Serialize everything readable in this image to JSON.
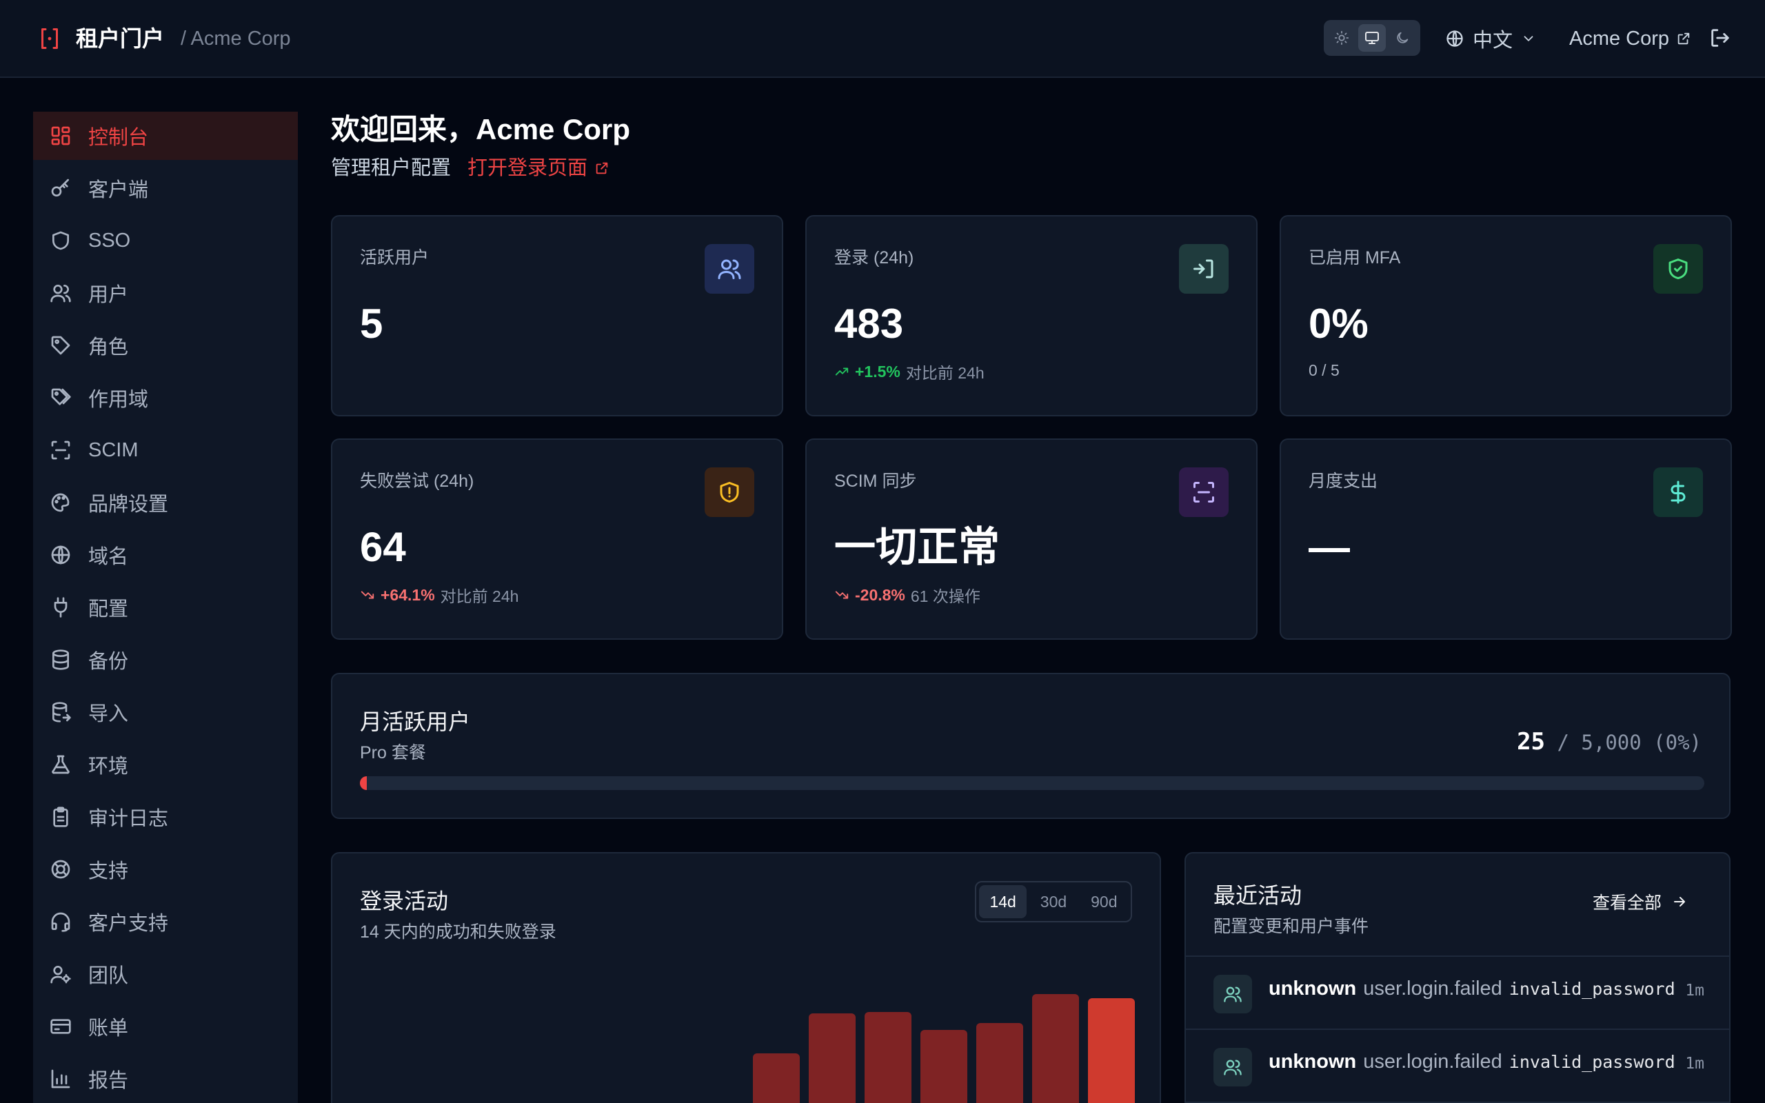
{
  "header": {
    "app_title": "租户门户",
    "tenant_path": "/ Acme Corp",
    "theme_options": [
      "light",
      "system",
      "dark"
    ],
    "theme_selected": "system",
    "language": "中文",
    "tenant_name": "Acme Corp"
  },
  "sidebar": {
    "items": [
      {
        "label": "控制台",
        "icon": "dashboard-icon",
        "active": true
      },
      {
        "label": "客户端",
        "icon": "key-icon"
      },
      {
        "label": "SSO",
        "icon": "shield-icon"
      },
      {
        "label": "用户",
        "icon": "users-icon"
      },
      {
        "label": "角色",
        "icon": "tag-icon"
      },
      {
        "label": "作用域",
        "icon": "tags-icon"
      },
      {
        "label": "SCIM",
        "icon": "scan-icon"
      },
      {
        "label": "品牌设置",
        "icon": "palette-icon"
      },
      {
        "label": "域名",
        "icon": "globe-icon"
      },
      {
        "label": "配置",
        "icon": "plug-icon"
      },
      {
        "label": "备份",
        "icon": "database-icon"
      },
      {
        "label": "导入",
        "icon": "database-import-icon"
      },
      {
        "label": "环境",
        "icon": "flask-icon"
      },
      {
        "label": "审计日志",
        "icon": "clipboard-icon"
      },
      {
        "label": "支持",
        "icon": "lifebuoy-icon"
      },
      {
        "label": "客户支持",
        "icon": "headset-icon"
      },
      {
        "label": "团队",
        "icon": "user-cog-icon"
      },
      {
        "label": "账单",
        "icon": "credit-card-icon"
      },
      {
        "label": "报告",
        "icon": "bar-chart-icon"
      }
    ]
  },
  "welcome": {
    "title": "欢迎回来，Acme Corp",
    "subtitle": "管理租户配置",
    "login_link": "打开登录页面"
  },
  "stats": [
    {
      "label": "活跃用户",
      "value": "5",
      "icon": "users-icon",
      "icon_bg": "#1e2a52",
      "icon_color": "#93b4ff"
    },
    {
      "label": "登录 (24h)",
      "value": "483",
      "delta": "+1.5%",
      "delta_dir": "up",
      "delta_note": "对比前 24h",
      "icon": "log-in-icon",
      "icon_bg": "#1f3b3d",
      "icon_color": "#b7e4e0"
    },
    {
      "label": "已启用 MFA",
      "value": "0%",
      "note": "0 / 5",
      "icon": "shield-check-icon",
      "icon_bg": "#123527",
      "icon_color": "#4ade80"
    },
    {
      "label": "失败尝试 (24h)",
      "value": "64",
      "delta": "+64.1%",
      "delta_dir": "down",
      "delta_note": "对比前 24h",
      "icon": "shield-alert-icon",
      "icon_bg": "#3a2316",
      "icon_color": "#fbbf24"
    },
    {
      "label": "SCIM 同步",
      "value": "一切正常",
      "delta": "-20.8%",
      "delta_dir": "down",
      "delta_note": "61 次操作",
      "icon": "scan-icon",
      "icon_bg": "#2e1b4a",
      "icon_color": "#c4b5fd"
    },
    {
      "label": "月度支出",
      "value": "—",
      "icon": "dollar-icon",
      "icon_bg": "#123531",
      "icon_color": "#5eead4"
    }
  ],
  "mau": {
    "title": "月活跃用户",
    "plan": "Pro 套餐",
    "count": "25",
    "limit_text": "/ 5,000 (0%)",
    "progress": 0.005
  },
  "login_activity": {
    "title": "登录活动",
    "subtitle": "14 天内的成功和失败登录",
    "ranges": [
      "14d",
      "30d",
      "90d"
    ],
    "range_selected": "14d"
  },
  "recent": {
    "title": "最近活动",
    "subtitle": "配置变更和用户事件",
    "view_all": "查看全部",
    "rows": [
      {
        "user": "unknown",
        "event": "user.login.failed",
        "detail": "invalid_password",
        "time": "1m"
      },
      {
        "user": "unknown",
        "event": "user.login.failed",
        "detail": "invalid_password",
        "time": "1m"
      }
    ]
  },
  "chart_data": {
    "type": "bar",
    "y_unit": "logins",
    "values": [
      null,
      null,
      null,
      null,
      null,
      null,
      90,
      148,
      150,
      124,
      134,
      176,
      170
    ],
    "highlight_last": true,
    "colors": {
      "bar": "#7f2324",
      "bar_last": "#cf3a2e"
    }
  }
}
